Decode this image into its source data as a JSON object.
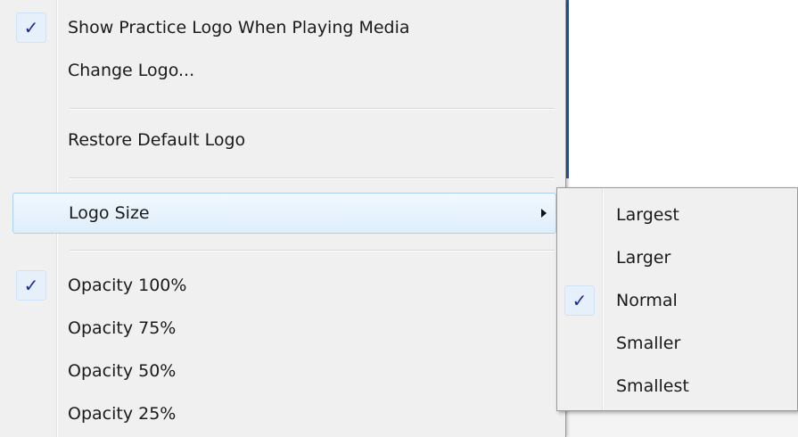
{
  "menu": {
    "items": [
      {
        "label": "Show Practice Logo When Playing Media",
        "checked": true
      },
      {
        "label": "Change Logo...",
        "checked": false
      },
      {
        "label": "Restore Default Logo",
        "checked": false
      },
      {
        "label": "Logo Size",
        "checked": false,
        "has_submenu": true,
        "highlighted": true
      },
      {
        "label": "Opacity 100%",
        "checked": true
      },
      {
        "label": "Opacity 75%",
        "checked": false
      },
      {
        "label": "Opacity 50%",
        "checked": false
      },
      {
        "label": "Opacity 25%",
        "checked": false
      }
    ],
    "check_glyph": "✓"
  },
  "submenu": {
    "items": [
      {
        "label": "Largest",
        "checked": false
      },
      {
        "label": "Larger",
        "checked": false
      },
      {
        "label": "Normal",
        "checked": true
      },
      {
        "label": "Smaller",
        "checked": false
      },
      {
        "label": "Smallest",
        "checked": false
      }
    ]
  },
  "colors": {
    "menu_bg": "#f0f0f0",
    "hover_border": "#aad1f3",
    "check_color": "#1a2a9c"
  }
}
